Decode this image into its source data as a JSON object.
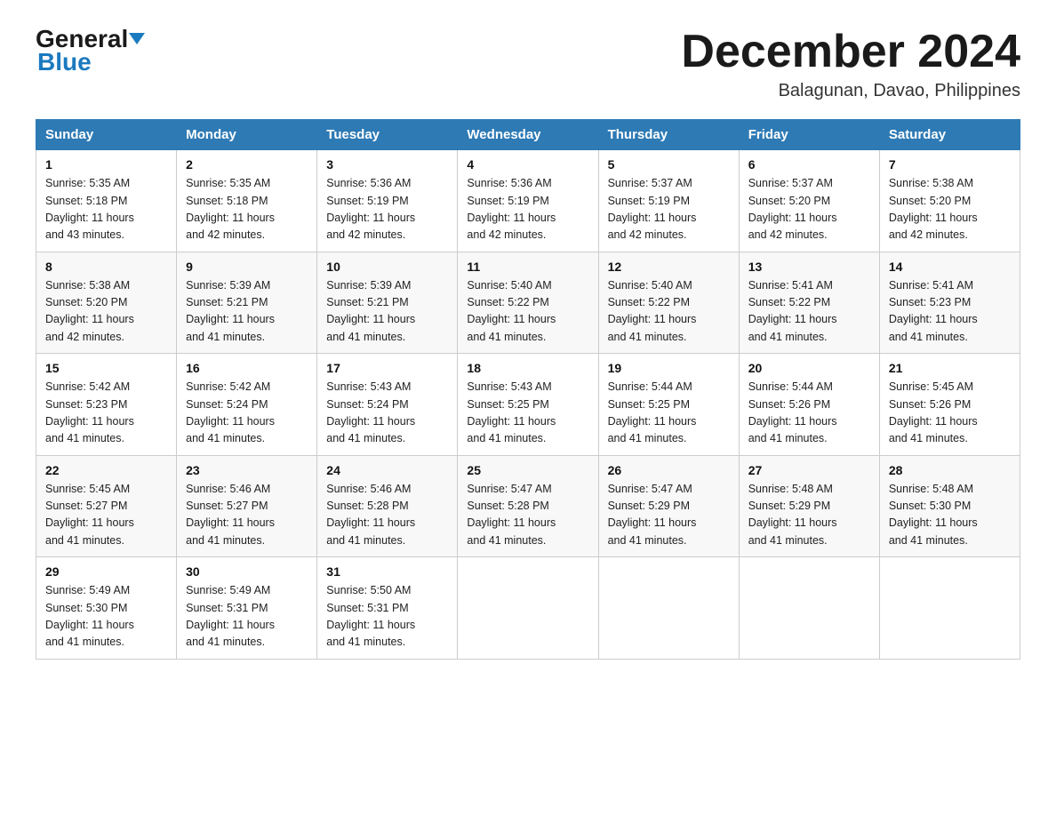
{
  "header": {
    "logo_general": "General",
    "logo_blue": "Blue",
    "month_title": "December 2024",
    "subtitle": "Balagunan, Davao, Philippines"
  },
  "days_of_week": [
    "Sunday",
    "Monday",
    "Tuesday",
    "Wednesday",
    "Thursday",
    "Friday",
    "Saturday"
  ],
  "weeks": [
    [
      {
        "day": "1",
        "sunrise": "5:35 AM",
        "sunset": "5:18 PM",
        "daylight": "11 hours and 43 minutes."
      },
      {
        "day": "2",
        "sunrise": "5:35 AM",
        "sunset": "5:18 PM",
        "daylight": "11 hours and 42 minutes."
      },
      {
        "day": "3",
        "sunrise": "5:36 AM",
        "sunset": "5:19 PM",
        "daylight": "11 hours and 42 minutes."
      },
      {
        "day": "4",
        "sunrise": "5:36 AM",
        "sunset": "5:19 PM",
        "daylight": "11 hours and 42 minutes."
      },
      {
        "day": "5",
        "sunrise": "5:37 AM",
        "sunset": "5:19 PM",
        "daylight": "11 hours and 42 minutes."
      },
      {
        "day": "6",
        "sunrise": "5:37 AM",
        "sunset": "5:20 PM",
        "daylight": "11 hours and 42 minutes."
      },
      {
        "day": "7",
        "sunrise": "5:38 AM",
        "sunset": "5:20 PM",
        "daylight": "11 hours and 42 minutes."
      }
    ],
    [
      {
        "day": "8",
        "sunrise": "5:38 AM",
        "sunset": "5:20 PM",
        "daylight": "11 hours and 42 minutes."
      },
      {
        "day": "9",
        "sunrise": "5:39 AM",
        "sunset": "5:21 PM",
        "daylight": "11 hours and 41 minutes."
      },
      {
        "day": "10",
        "sunrise": "5:39 AM",
        "sunset": "5:21 PM",
        "daylight": "11 hours and 41 minutes."
      },
      {
        "day": "11",
        "sunrise": "5:40 AM",
        "sunset": "5:22 PM",
        "daylight": "11 hours and 41 minutes."
      },
      {
        "day": "12",
        "sunrise": "5:40 AM",
        "sunset": "5:22 PM",
        "daylight": "11 hours and 41 minutes."
      },
      {
        "day": "13",
        "sunrise": "5:41 AM",
        "sunset": "5:22 PM",
        "daylight": "11 hours and 41 minutes."
      },
      {
        "day": "14",
        "sunrise": "5:41 AM",
        "sunset": "5:23 PM",
        "daylight": "11 hours and 41 minutes."
      }
    ],
    [
      {
        "day": "15",
        "sunrise": "5:42 AM",
        "sunset": "5:23 PM",
        "daylight": "11 hours and 41 minutes."
      },
      {
        "day": "16",
        "sunrise": "5:42 AM",
        "sunset": "5:24 PM",
        "daylight": "11 hours and 41 minutes."
      },
      {
        "day": "17",
        "sunrise": "5:43 AM",
        "sunset": "5:24 PM",
        "daylight": "11 hours and 41 minutes."
      },
      {
        "day": "18",
        "sunrise": "5:43 AM",
        "sunset": "5:25 PM",
        "daylight": "11 hours and 41 minutes."
      },
      {
        "day": "19",
        "sunrise": "5:44 AM",
        "sunset": "5:25 PM",
        "daylight": "11 hours and 41 minutes."
      },
      {
        "day": "20",
        "sunrise": "5:44 AM",
        "sunset": "5:26 PM",
        "daylight": "11 hours and 41 minutes."
      },
      {
        "day": "21",
        "sunrise": "5:45 AM",
        "sunset": "5:26 PM",
        "daylight": "11 hours and 41 minutes."
      }
    ],
    [
      {
        "day": "22",
        "sunrise": "5:45 AM",
        "sunset": "5:27 PM",
        "daylight": "11 hours and 41 minutes."
      },
      {
        "day": "23",
        "sunrise": "5:46 AM",
        "sunset": "5:27 PM",
        "daylight": "11 hours and 41 minutes."
      },
      {
        "day": "24",
        "sunrise": "5:46 AM",
        "sunset": "5:28 PM",
        "daylight": "11 hours and 41 minutes."
      },
      {
        "day": "25",
        "sunrise": "5:47 AM",
        "sunset": "5:28 PM",
        "daylight": "11 hours and 41 minutes."
      },
      {
        "day": "26",
        "sunrise": "5:47 AM",
        "sunset": "5:29 PM",
        "daylight": "11 hours and 41 minutes."
      },
      {
        "day": "27",
        "sunrise": "5:48 AM",
        "sunset": "5:29 PM",
        "daylight": "11 hours and 41 minutes."
      },
      {
        "day": "28",
        "sunrise": "5:48 AM",
        "sunset": "5:30 PM",
        "daylight": "11 hours and 41 minutes."
      }
    ],
    [
      {
        "day": "29",
        "sunrise": "5:49 AM",
        "sunset": "5:30 PM",
        "daylight": "11 hours and 41 minutes."
      },
      {
        "day": "30",
        "sunrise": "5:49 AM",
        "sunset": "5:31 PM",
        "daylight": "11 hours and 41 minutes."
      },
      {
        "day": "31",
        "sunrise": "5:50 AM",
        "sunset": "5:31 PM",
        "daylight": "11 hours and 41 minutes."
      },
      null,
      null,
      null,
      null
    ]
  ],
  "labels": {
    "sunrise": "Sunrise:",
    "sunset": "Sunset:",
    "daylight": "Daylight:"
  }
}
